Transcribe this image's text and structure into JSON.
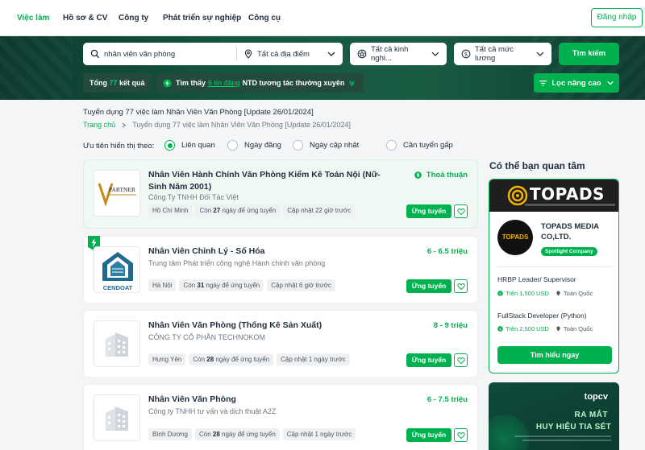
{
  "nav": {
    "items": [
      "Việc làm",
      "Hồ sơ & CV",
      "Công ty",
      "Phát triển sự nghiệp",
      "Công cụ"
    ],
    "login_label": "Đăng nhập"
  },
  "search": {
    "keyword": "nhân viên văn phòng",
    "location": "Tất cả địa điểm",
    "experience": "Tất cả kinh nghi...",
    "salary": "Tất cả mức lương",
    "button": "Tìm kiếm",
    "result_prefix": "Tổng",
    "result_count": "77",
    "result_suffix": "kết quả",
    "found_prefix": "Tìm thấy",
    "found_link": "6 tin đăng",
    "found_suffix": "NTD tương tác thường xuyên",
    "advanced_filter": "Lọc nâng cao"
  },
  "page": {
    "heading": "Tuyển dụng 77 việc làm Nhân Viên Văn Phòng [Update 26/01/2024]",
    "breadcrumb_home": "Trang chủ",
    "breadcrumb_current": "Tuyển dụng 77 việc làm Nhân Viên Văn Phòng [Update 26/01/2024]"
  },
  "sort": {
    "label": "Ưu tiên hiển thị theo:",
    "options": [
      "Liên quan",
      "Ngày đăng",
      "Ngày cập nhật",
      "Cần tuyển gấp"
    ],
    "selected": "Liên quan"
  },
  "jobs": [
    {
      "title": "Nhân Viên Hành Chính Văn Phòng Kiểm Kê Toán Nội (Nữ- Sinh Năm 2001)",
      "company": "Công Ty TNHH Đối Tác Việt",
      "salary": "Thoả thuận",
      "location": "Hồ Chí Minh",
      "days_prefix": "Còn",
      "days": "27",
      "days_suffix": "ngày để ứng tuyển",
      "updated": "Cập nhật 22 giờ trước",
      "apply": "Ứng tuyển",
      "logo_text": "PARTNER"
    },
    {
      "title": "Nhân Viên Chỉnh Lý - Số Hóa",
      "company": "Trung tâm Phát triển công nghệ Hành chính văn phòng",
      "salary": "6 - 6.5 triệu",
      "location": "Hà Nội",
      "days_prefix": "Còn",
      "days": "31",
      "days_suffix": "ngày để ứng tuyển",
      "updated": "Cập nhật 6 giờ trước",
      "apply": "Ứng tuyển",
      "logo_text": "CENDOAT"
    },
    {
      "title": "Nhân Viên Văn Phòng (Thống Kê Sản Xuất)",
      "company": "CÔNG TY CỔ PHẦN TECHNOKOM",
      "salary": "8 - 9 triệu",
      "location": "Hưng Yên",
      "days_prefix": "Còn",
      "days": "28",
      "days_suffix": "ngày để ứng tuyển",
      "updated": "Cập nhật 1 ngày trước",
      "apply": "Ứng tuyển"
    },
    {
      "title": "Nhân Viên Văn Phòng",
      "company": "Công ty TNHH tư vấn và dịch thuật A2Z",
      "salary": "6 - 7.5 triệu",
      "location": "Bình Dương",
      "days_prefix": "Còn",
      "days": "28",
      "days_suffix": "ngày để ứng tuyển",
      "updated": "Cập nhật 1 ngày trước",
      "apply": "Ứng tuyển"
    }
  ],
  "sidebar": {
    "title": "Có thể bạn quan tâm",
    "ad": {
      "banner_brand": "TOPADS",
      "logo_text": "TOPADS",
      "company": "TOPADS MEDIA CO,LTD.",
      "badge": "Spotlight Company",
      "jobs": [
        {
          "title": "HRBP Leader/ Supervisor",
          "salary": "Trên 1,500 USD",
          "location": "Toàn Quốc"
        },
        {
          "title": "FullStack Developer (Python)",
          "salary": "Trên 2,500 USD",
          "location": "Toàn Quốc"
        }
      ],
      "button": "Tìm hiểu ngay"
    },
    "promo": {
      "brand": "topcv",
      "line1": "RA MẮT",
      "line2": "HUY HIỆU TIA SÉT"
    }
  },
  "colors": {
    "primary": "#00b14f",
    "band_dark": "#0d3a2f",
    "text": "#212f3f"
  }
}
